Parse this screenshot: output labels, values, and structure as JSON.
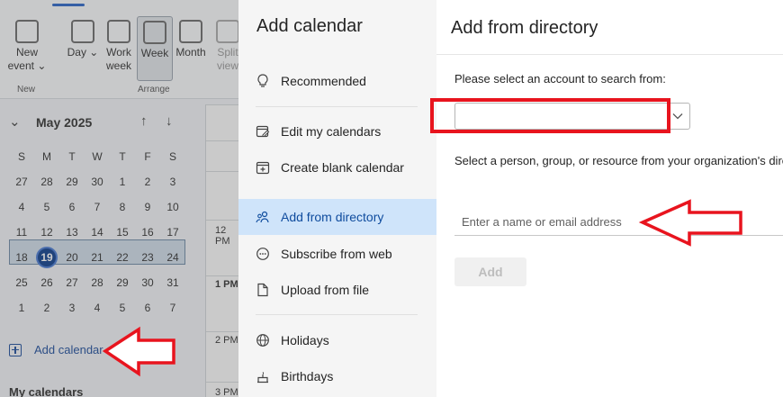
{
  "background": {
    "ribbon": {
      "buttons": [
        {
          "id": "new-event",
          "label": "New event ⌄"
        },
        {
          "id": "day",
          "label": "Day ⌄"
        },
        {
          "id": "work-week",
          "label": "Work week"
        },
        {
          "id": "week",
          "label": "Week"
        },
        {
          "id": "month",
          "label": "Month"
        },
        {
          "id": "split-view",
          "label": "Split view"
        }
      ],
      "group_new": "New",
      "group_arrange": "Arrange"
    },
    "mini_calendar": {
      "month_label": "May 2025",
      "weekdays": [
        "S",
        "M",
        "T",
        "W",
        "T",
        "F",
        "S"
      ],
      "weeks": [
        [
          "27",
          "28",
          "29",
          "30",
          "1",
          "2",
          "3"
        ],
        [
          "4",
          "5",
          "6",
          "7",
          "8",
          "9",
          "10"
        ],
        [
          "11",
          "12",
          "13",
          "14",
          "15",
          "16",
          "17"
        ],
        [
          "18",
          "19",
          "20",
          "21",
          "22",
          "23",
          "24"
        ],
        [
          "25",
          "26",
          "27",
          "28",
          "29",
          "30",
          "31"
        ],
        [
          "1",
          "2",
          "3",
          "4",
          "5",
          "6",
          "7"
        ]
      ],
      "today": "19"
    },
    "add_calendar_link": "Add calendar",
    "my_calendars": "My calendars",
    "times": [
      "12 PM",
      "1 PM",
      "2 PM",
      "3 PM"
    ]
  },
  "nav": {
    "title": "Add calendar",
    "items": [
      {
        "label": "Recommended",
        "icon": "lightbulb-icon"
      },
      {
        "label": "Edit my calendars",
        "icon": "edit-calendar-icon"
      },
      {
        "label": "Create blank calendar",
        "icon": "add-calendar-icon"
      },
      {
        "label": "Add from directory",
        "icon": "people-icon"
      },
      {
        "label": "Subscribe from web",
        "icon": "link-icon"
      },
      {
        "label": "Upload from file",
        "icon": "file-icon"
      },
      {
        "label": "Holidays",
        "icon": "globe-icon"
      },
      {
        "label": "Birthdays",
        "icon": "cake-icon"
      }
    ],
    "active": "Add from directory"
  },
  "content": {
    "title": "Add from directory",
    "account_label": "Please select an account to search from:",
    "account_value": "",
    "person_label": "Select a person, group, or resource from your organization's directory",
    "name_placeholder": "Enter a name or email address",
    "add_button": "Add"
  },
  "colors": {
    "accent": "#0f4c9e",
    "active_bg": "#cfe4fa",
    "annotation_red": "#e8141e"
  }
}
